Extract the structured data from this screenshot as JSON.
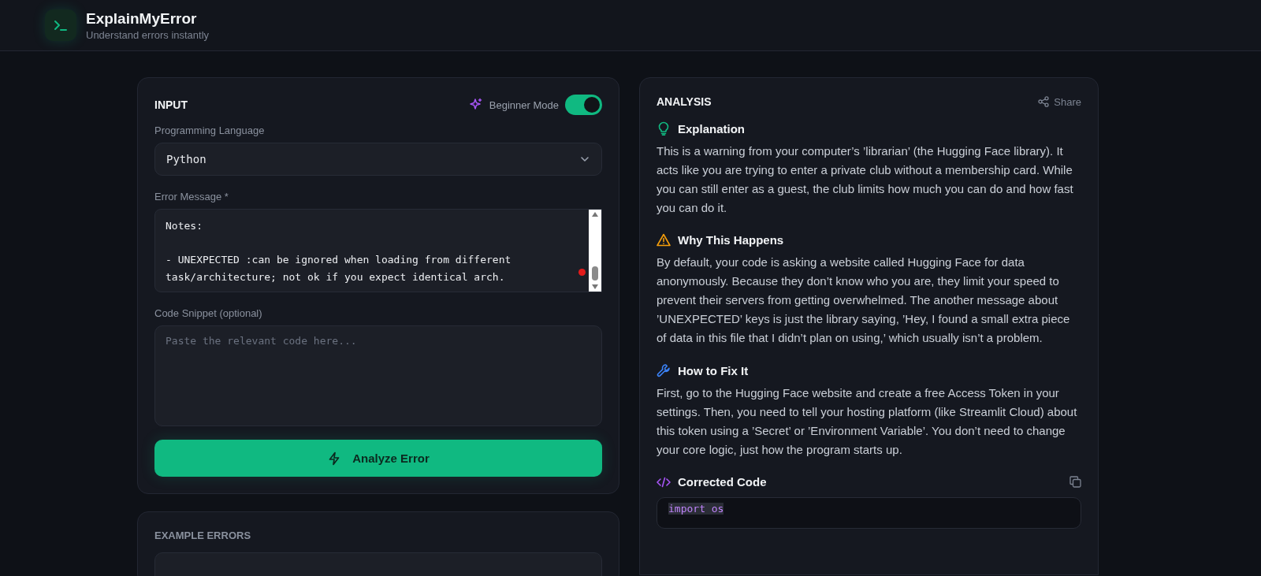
{
  "header": {
    "title": "ExplainMyError",
    "subtitle": "Understand errors instantly"
  },
  "input": {
    "title": "INPUT",
    "beginner_mode": {
      "label": "Beginner Mode",
      "on": true
    },
    "language": {
      "label": "Programming Language",
      "value": "Python"
    },
    "error_message": {
      "label": "Error Message *",
      "value": "Notes:\n\n- UNEXPECTED :can be ignored when loading from different task/architecture; not ok if you expect identical arch."
    },
    "code_snippet": {
      "label": "Code Snippet (optional)",
      "placeholder": "Paste the relevant code here..."
    },
    "analyze_button": "Analyze Error"
  },
  "examples": {
    "title": "EXAMPLE ERRORS"
  },
  "analysis": {
    "title": "ANALYSIS",
    "share": "Share",
    "sections": [
      {
        "kind": "explanation",
        "title": "Explanation",
        "text": "This is a warning from your computer’s ’librarian’ (the Hugging Face library). It acts like you are trying to enter a private club without a membership card. While you can still enter as a guest, the club limits how much you can do and how fast you can do it."
      },
      {
        "kind": "cause",
        "title": "Why This Happens",
        "text": "By default, your code is asking a website called Hugging Face for data anonymously. Because they don’t know who you are, they limit your speed to prevent their servers from getting overwhelmed. The another message about ’UNEXPECTED’ keys is just the library saying, ’Hey, I found a small extra piece of data in this file that I didn’t plan on using,’ which usually isn’t a problem."
      },
      {
        "kind": "fix",
        "title": "How to Fix It",
        "text": "First, go to the Hugging Face website and create a free Access Token in your settings. Then, you need to tell your hosting platform (like Streamlit Cloud) about this token using a ’Secret’ or ’Environment Variable’. You don’t need to change your core logic, just how the program starts up."
      }
    ],
    "corrected_code": {
      "title": "Corrected Code",
      "code": "import os"
    }
  }
}
